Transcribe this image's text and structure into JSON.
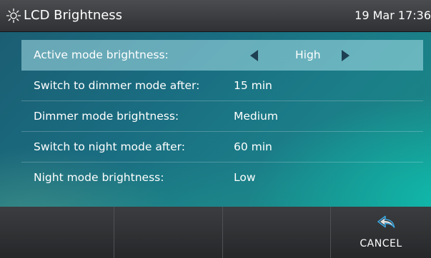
{
  "header": {
    "icon": "sun-icon",
    "title": "LCD Brightness",
    "datetime": "19 Mar 17:36"
  },
  "settings": [
    {
      "label": "Active mode brightness:",
      "value": "High",
      "selected": true
    },
    {
      "label": "Switch to dimmer mode after:",
      "value": "15 min",
      "selected": false
    },
    {
      "label": "Dimmer mode brightness:",
      "value": "Medium",
      "selected": false
    },
    {
      "label": "Switch to night mode after:",
      "value": "60 min",
      "selected": false
    },
    {
      "label": "Night mode brightness:",
      "value": "Low",
      "selected": false
    }
  ],
  "softkeys": [
    {
      "label": ""
    },
    {
      "label": ""
    },
    {
      "label": ""
    },
    {
      "label": "CANCEL",
      "icon": "back-arrow-icon"
    }
  ],
  "colors": {
    "selection_arrows": "#1e3f52",
    "cancel_icon": "#3aa6e0"
  }
}
